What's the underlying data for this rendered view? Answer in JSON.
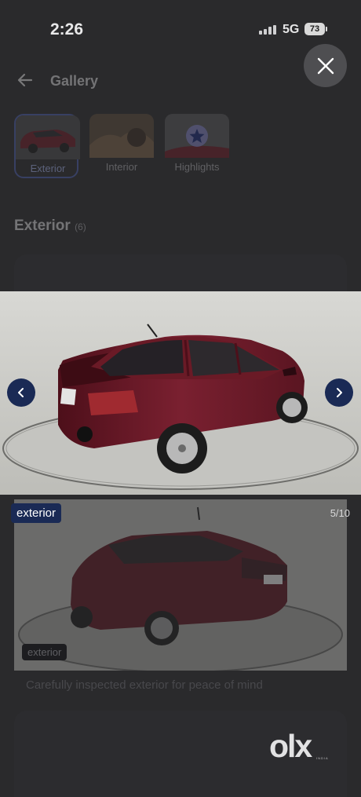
{
  "status": {
    "time": "2:26",
    "network": "5G",
    "battery": "73"
  },
  "header": {
    "title": "Gallery"
  },
  "tabs": [
    {
      "label": "Exterior",
      "active": true
    },
    {
      "label": "Interior",
      "active": false
    },
    {
      "label": "Highlights",
      "active": false
    }
  ],
  "section": {
    "title": "Exterior",
    "count": "(6)"
  },
  "viewer": {
    "tag": "exterior",
    "counter": "5/10"
  },
  "preview": {
    "tag": "exterior",
    "caption": "Carefully inspected exterior for peace of mind"
  },
  "brand": {
    "logo": "olx",
    "sub": "INDIA"
  },
  "colors": {
    "accent": "#1a2a55",
    "car": "#6b1c28",
    "overlay": "#2a2a2c"
  },
  "icons": {
    "close": "close-icon",
    "back": "back-arrow-icon",
    "prev": "chevron-left-icon",
    "next": "chevron-right-icon",
    "star": "star-icon"
  }
}
